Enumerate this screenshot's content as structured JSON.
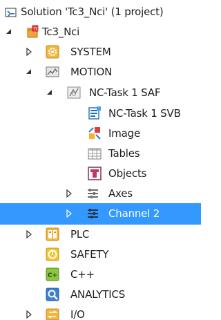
{
  "tree": {
    "solution": {
      "label": "Solution 'Tc3_Nci' (1 project)",
      "icon": "solution-icon"
    },
    "project": {
      "label": "Tc3_Nci",
      "icon": "project-icon",
      "expanded": true
    },
    "system": {
      "label": "SYSTEM",
      "icon": "system-gear-icon",
      "expanded": false
    },
    "motion": {
      "label": "MOTION",
      "icon": "motion-icon",
      "expanded": true
    },
    "nc_task_saf": {
      "label": "NC-Task 1 SAF",
      "icon": "nc-task-icon",
      "expanded": true
    },
    "nc_task_svb": {
      "label": "NC-Task 1 SVB",
      "icon": "svb-icon"
    },
    "image": {
      "label": "Image",
      "icon": "image-icon"
    },
    "tables": {
      "label": "Tables",
      "icon": "tables-icon"
    },
    "objects": {
      "label": "Objects",
      "icon": "objects-icon"
    },
    "axes": {
      "label": "Axes",
      "icon": "axes-icon",
      "expanded": false
    },
    "channel2": {
      "label": "Channel 2",
      "icon": "channel-icon",
      "expanded": false,
      "selected": true
    },
    "plc": {
      "label": "PLC",
      "icon": "plc-icon",
      "expanded": false
    },
    "safety": {
      "label": "SAFETY",
      "icon": "safety-icon"
    },
    "cpp": {
      "label": "C++",
      "icon": "cpp-icon"
    },
    "analytics": {
      "label": "ANALYTICS",
      "icon": "analytics-icon"
    },
    "io": {
      "label": "I/O",
      "icon": "io-icon",
      "expanded": false
    }
  },
  "colors": {
    "selection": "#3399ff",
    "text": "#1e1e1e",
    "arrow": "#333333"
  }
}
